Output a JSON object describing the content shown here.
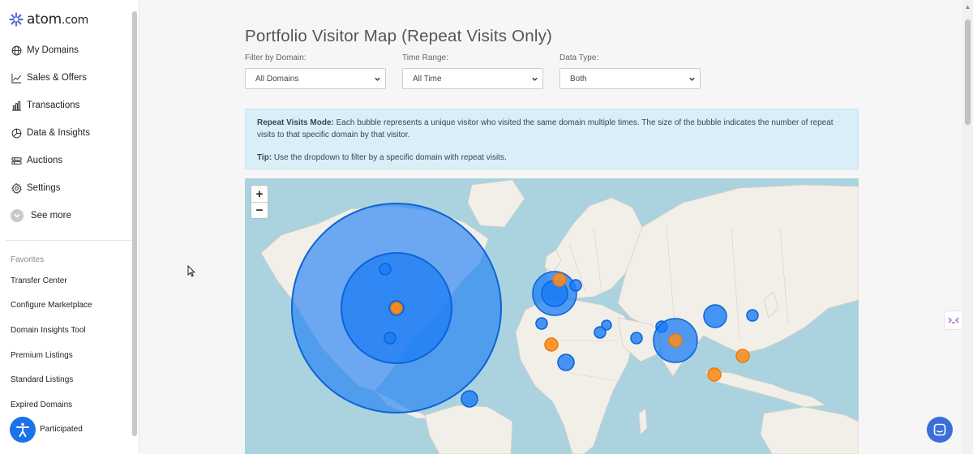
{
  "brand": {
    "name": "atom",
    "suffix": ".com",
    "color": "#5b6bd6"
  },
  "sidebar": {
    "items": [
      {
        "label": "My Domains",
        "icon": "globe-icon"
      },
      {
        "label": "Sales & Offers",
        "icon": "trend-chart-icon"
      },
      {
        "label": "Transactions",
        "icon": "bar-chart-icon"
      },
      {
        "label": "Data & Insights",
        "icon": "pie-chart-icon"
      },
      {
        "label": "Auctions",
        "icon": "auction-icon"
      },
      {
        "label": "Settings",
        "icon": "gear-icon"
      },
      {
        "label": "See more",
        "icon": "chevron-down-icon"
      }
    ],
    "favorites_heading": "Favorites",
    "favorites": [
      "Transfer Center",
      "Configure Marketplace",
      "Domain Insights Tool",
      "Premium Listings",
      "Standard Listings",
      "Expired Domains",
      "Participated"
    ]
  },
  "main": {
    "title": "Portfolio Visitor Map (Repeat Visits Only)",
    "filters": [
      {
        "label": "Filter by Domain:",
        "value": "All Domains"
      },
      {
        "label": "Time Range:",
        "value": "All Time"
      },
      {
        "label": "Data Type:",
        "value": "Both"
      }
    ],
    "info": {
      "mode_title": "Repeat Visits Mode:",
      "mode_text": " Each bubble represents a unique visitor who visited the same domain multiple times. The size of the bubble indicates the number of repeat visits to that specific domain by that visitor.",
      "tip_title": "Tip:",
      "tip_text": " Use the dropdown to filter by a specific domain with repeat visits."
    },
    "map": {
      "zoom_in": "+",
      "zoom_out": "−",
      "colors": {
        "water": "#aad3df",
        "land": "#f2efe9",
        "blue": "#1a7cf5",
        "orange": "#ff8c1a"
      }
    }
  }
}
